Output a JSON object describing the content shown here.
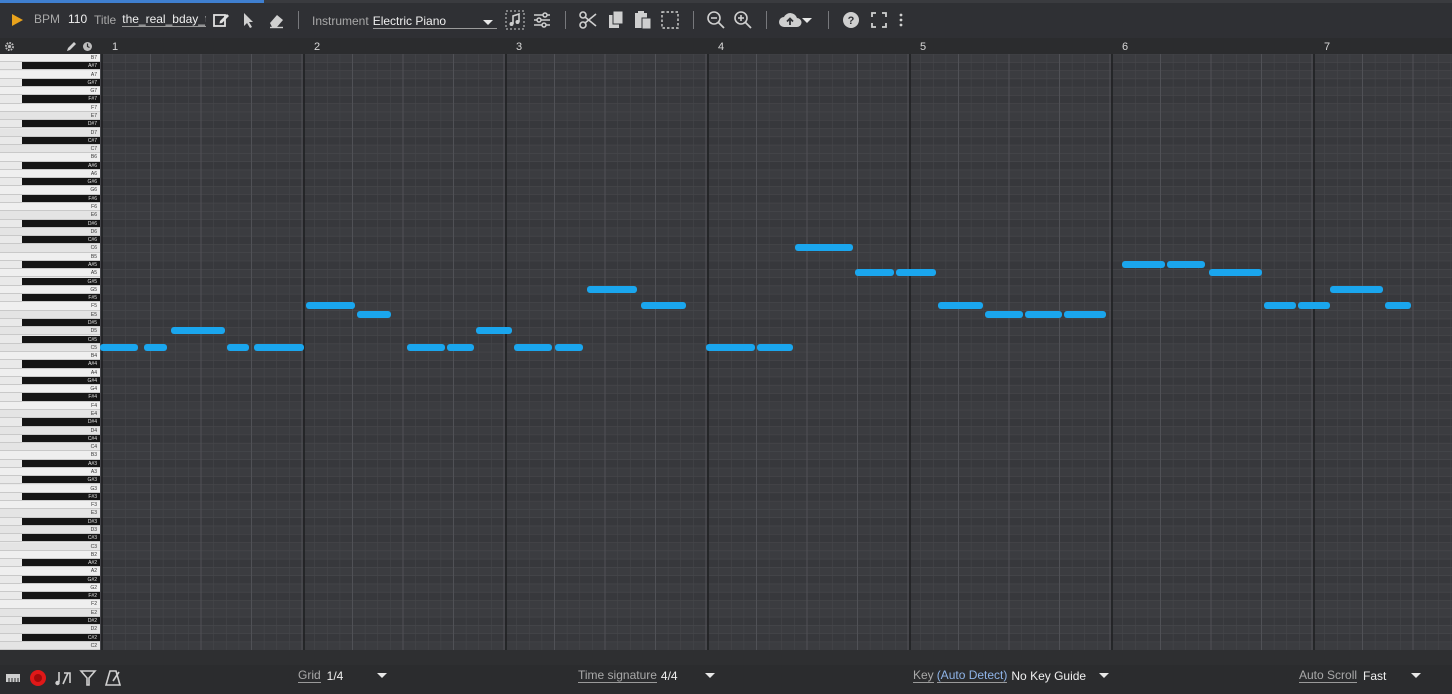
{
  "toolbar": {
    "bpm_label": "BPM",
    "bpm_value": "110",
    "title_label": "Title",
    "title_value": "the_real_bday_t",
    "instrument_label": "Instrument",
    "instrument_value": "Electric Piano",
    "icons": [
      "play-icon",
      "edit-icon",
      "pointer-icon",
      "eraser-icon",
      "sample-icon",
      "settings-sliders-icon",
      "scissors-icon",
      "copy-icon",
      "paste-icon",
      "select-icon",
      "zoom-out-icon",
      "zoom-in-icon",
      "cloud-upload-icon",
      "help-icon",
      "fullscreen-icon",
      "more-icon"
    ],
    "accent_color": "#e8a21c"
  },
  "ruler": {
    "bars": [
      "1",
      "2",
      "3",
      "4",
      "5",
      "6",
      "7"
    ]
  },
  "keys": [
    "B7",
    "A#7",
    "A7",
    "G#7",
    "G7",
    "F#7",
    "F7",
    "E7",
    "D#7",
    "D7",
    "C#7",
    "C7",
    "B6",
    "A#6",
    "A6",
    "G#6",
    "G6",
    "F#6",
    "F6",
    "E6",
    "D#6",
    "D6",
    "C#6",
    "C6",
    "B5",
    "A#5",
    "A5",
    "G#5",
    "G5",
    "F#5",
    "F5",
    "E5",
    "D#5",
    "D5",
    "C#5",
    "C5",
    "B4",
    "A#4",
    "A4",
    "G#4",
    "G4",
    "F#4",
    "F4",
    "E4",
    "D#4",
    "D4",
    "C#4",
    "C4",
    "B3",
    "A#3",
    "A3",
    "G#3",
    "G3",
    "F#3",
    "F3",
    "E3",
    "D#3",
    "D3",
    "C#3",
    "C3",
    "B2",
    "A#2",
    "A2",
    "G#2",
    "G2",
    "F#2",
    "F2",
    "E2",
    "D#2",
    "D2",
    "C#2",
    "C2"
  ],
  "notes": [
    {
      "pitch": "C5",
      "start": 1.0,
      "dur": 0.2,
      "bar": 1
    },
    {
      "pitch": "C5",
      "start": 1.22,
      "dur": 0.12,
      "bar": 1
    },
    {
      "pitch": "D5",
      "start": 1.35,
      "dur": 0.28,
      "bar": 1
    },
    {
      "pitch": "C5",
      "start": 1.63,
      "dur": 0.12,
      "bar": 1
    },
    {
      "pitch": "C5",
      "start": 1.76,
      "dur": 0.26,
      "bar": 1
    },
    {
      "pitch": "F5",
      "start": 2.02,
      "dur": 0.25,
      "bar": 2
    },
    {
      "pitch": "E5",
      "start": 2.27,
      "dur": 0.18,
      "bar": 2
    },
    {
      "pitch": "C5",
      "start": 2.52,
      "dur": 0.2,
      "bar": 2
    },
    {
      "pitch": "C5",
      "start": 2.72,
      "dur": 0.14,
      "bar": 2
    },
    {
      "pitch": "D5",
      "start": 2.86,
      "dur": 0.19,
      "bar": 2
    },
    {
      "pitch": "C5",
      "start": 3.05,
      "dur": 0.2,
      "bar": 3
    },
    {
      "pitch": "C5",
      "start": 3.25,
      "dur": 0.15,
      "bar": 3
    },
    {
      "pitch": "G5",
      "start": 3.41,
      "dur": 0.26,
      "bar": 3
    },
    {
      "pitch": "F5",
      "start": 3.68,
      "dur": 0.23,
      "bar": 3
    },
    {
      "pitch": "C5",
      "start": 4.0,
      "dur": 0.25,
      "bar": 4
    },
    {
      "pitch": "C5",
      "start": 4.25,
      "dur": 0.19,
      "bar": 4
    },
    {
      "pitch": "C6",
      "start": 4.44,
      "dur": 0.3,
      "bar": 4
    },
    {
      "pitch": "A5",
      "start": 4.74,
      "dur": 0.2,
      "bar": 4
    },
    {
      "pitch": "A5",
      "start": 4.94,
      "dur": 0.21,
      "bar": 4
    },
    {
      "pitch": "F5",
      "start": 5.15,
      "dur": 0.23,
      "bar": 5
    },
    {
      "pitch": "E5",
      "start": 5.38,
      "dur": 0.2,
      "bar": 5
    },
    {
      "pitch": "E5",
      "start": 5.58,
      "dur": 0.19,
      "bar": 5
    },
    {
      "pitch": "E5",
      "start": 5.77,
      "dur": 0.22,
      "bar": 5
    },
    {
      "pitch": "A#5",
      "start": 6.06,
      "dur": 0.22,
      "bar": 6
    },
    {
      "pitch": "A#5",
      "start": 6.28,
      "dur": 0.2,
      "bar": 6
    },
    {
      "pitch": "A5",
      "start": 6.49,
      "dur": 0.27,
      "bar": 6
    },
    {
      "pitch": "F5",
      "start": 6.76,
      "dur": 0.17,
      "bar": 6
    },
    {
      "pitch": "F5",
      "start": 6.93,
      "dur": 0.17,
      "bar": 6
    },
    {
      "pitch": "G5",
      "start": 7.09,
      "dur": 0.27,
      "bar": 7
    },
    {
      "pitch": "F5",
      "start": 7.36,
      "dur": 0.14,
      "bar": 7
    }
  ],
  "note_color": "#1aa6ee",
  "bottom": {
    "grid_label": "Grid",
    "grid_value": "1/4",
    "timesig_label": "Time signature",
    "timesig_value": "4/4",
    "key_label": "Key",
    "key_link": "(Auto Detect)",
    "key_value": "No Key Guide",
    "autoscroll_label": "Auto Scroll",
    "autoscroll_value": "Fast",
    "icons": [
      "piano-icon",
      "record-icon",
      "notes-icon",
      "filter-icon",
      "metronome-icon"
    ],
    "record_color": "#e01818"
  }
}
